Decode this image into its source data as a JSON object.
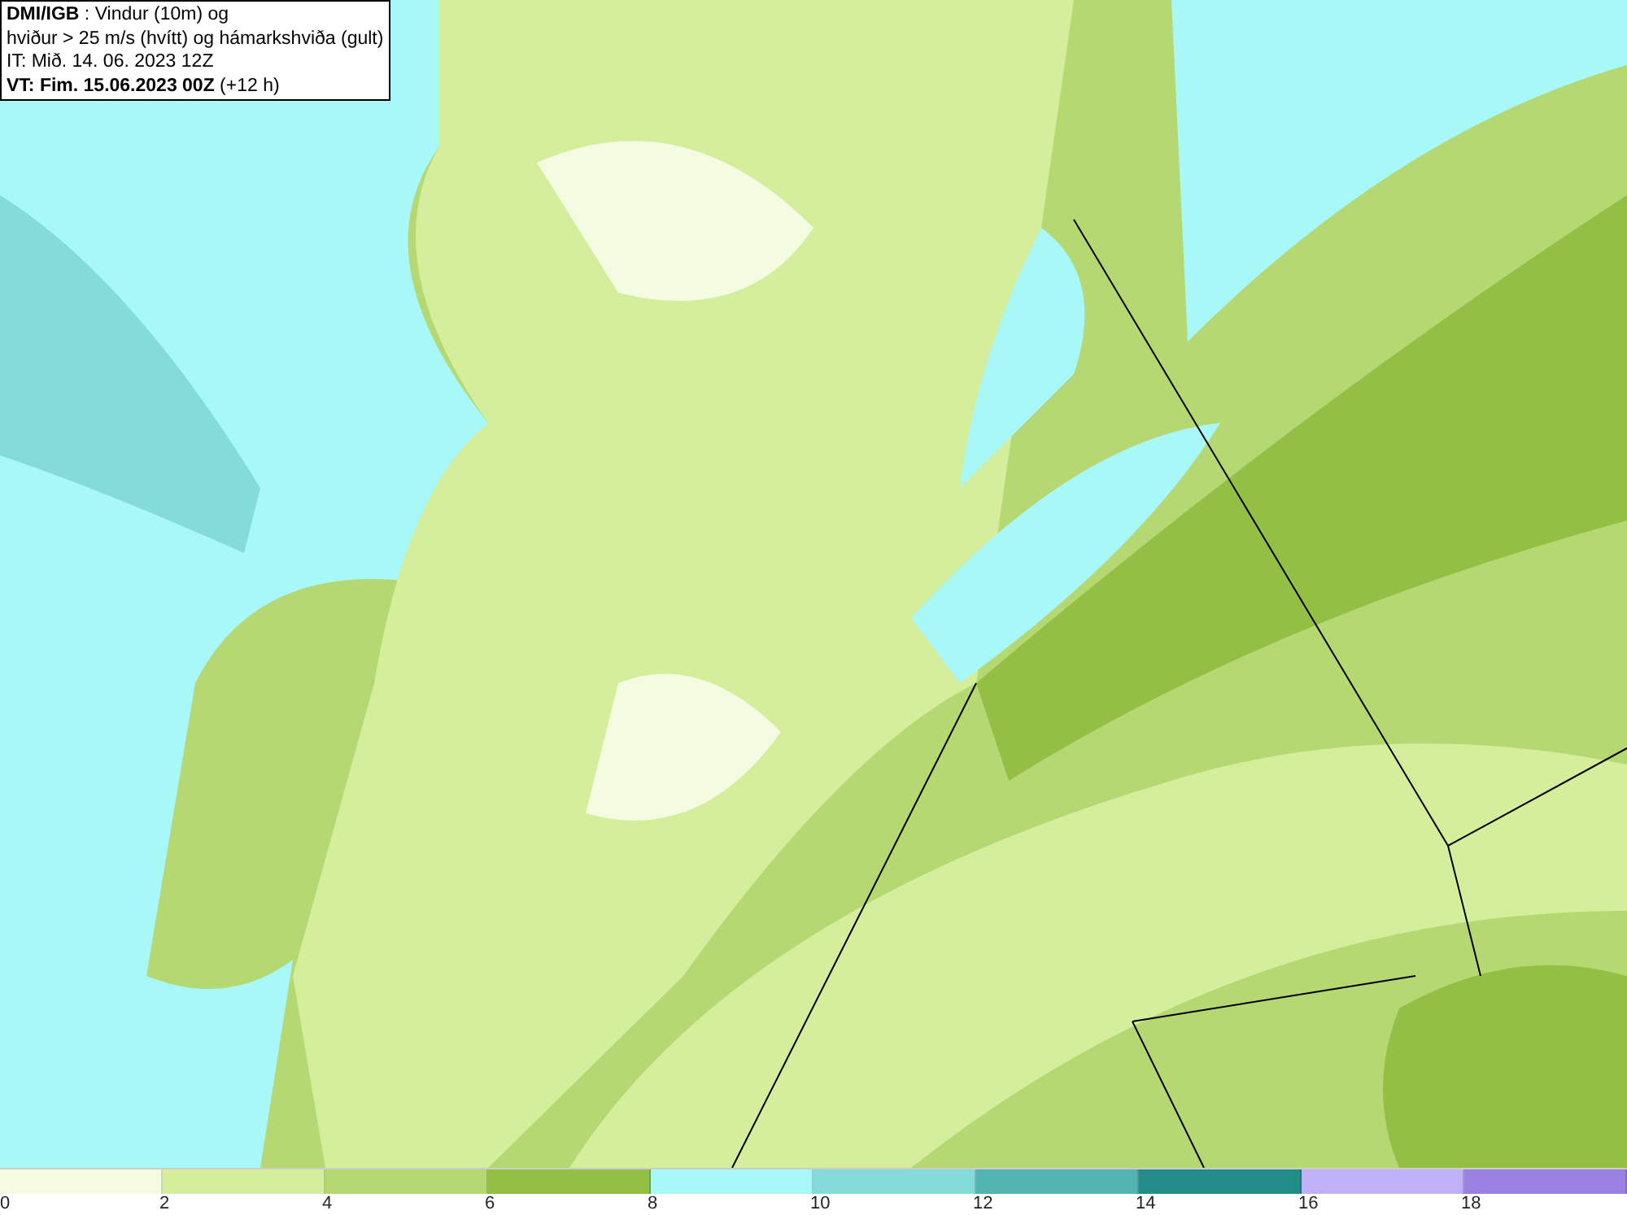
{
  "title_box": {
    "lines": [
      "**DMI/IGB** : Vindur (10m) og",
      "hviður > 25 m/s (hvítt) og hámarkshviða (gult)",
      "IT: Mið. 14. 06. 2023 12Z",
      "**VT: Fim. 15.06.2023 00Z** (+12 h)"
    ]
  },
  "legend": [
    {
      "label": "0",
      "color": "#f5fbe0"
    },
    {
      "label": "2",
      "color": "#d4ee9c"
    },
    {
      "label": "4",
      "color": "#b5d872"
    },
    {
      "label": "6",
      "color": "#94bf45"
    },
    {
      "label": "8",
      "color": "#a8f8f8"
    },
    {
      "label": "10",
      "color": "#84dcd8"
    },
    {
      "label": "12",
      "color": "#52b4b0"
    },
    {
      "label": "14",
      "color": "#228c88"
    },
    {
      "label": "16",
      "color": "#c0b0f8"
    },
    {
      "label": "18",
      "color": "#9a80e0"
    }
  ]
}
